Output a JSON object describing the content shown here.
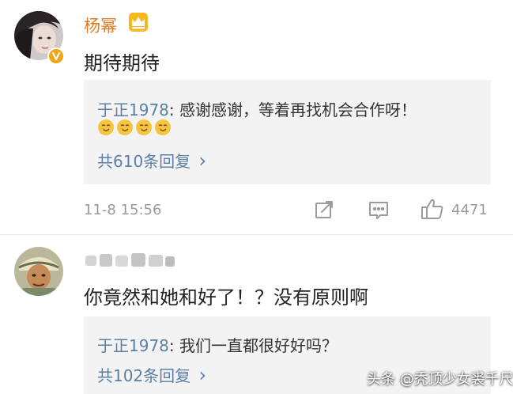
{
  "comment1": {
    "username": "杨幂",
    "text": "期待期待",
    "reply": {
      "author": "于正1978",
      "separator": ": ",
      "text": "感谢感谢，等着再找机会合作呀！",
      "emoji_count": 4,
      "count_label": "共610条回复",
      "chevron": "›"
    },
    "timestamp": "11-8 15:56",
    "like_count": "4471"
  },
  "comment2": {
    "username": "",
    "text": "你竟然和她和好了！？没有原则啊",
    "reply": {
      "author": "于正1978",
      "separator": ": ",
      "text": "我们一直都很好好吗？",
      "count_label": "共102条回复",
      "chevron": "›"
    }
  },
  "watermark": "头条 @秃顶少女裘千尺",
  "colors": {
    "username": "#e07b24",
    "link": "#5b7fa6",
    "gray": "#9b9b9b",
    "reply_bg": "#f3f3f3"
  }
}
